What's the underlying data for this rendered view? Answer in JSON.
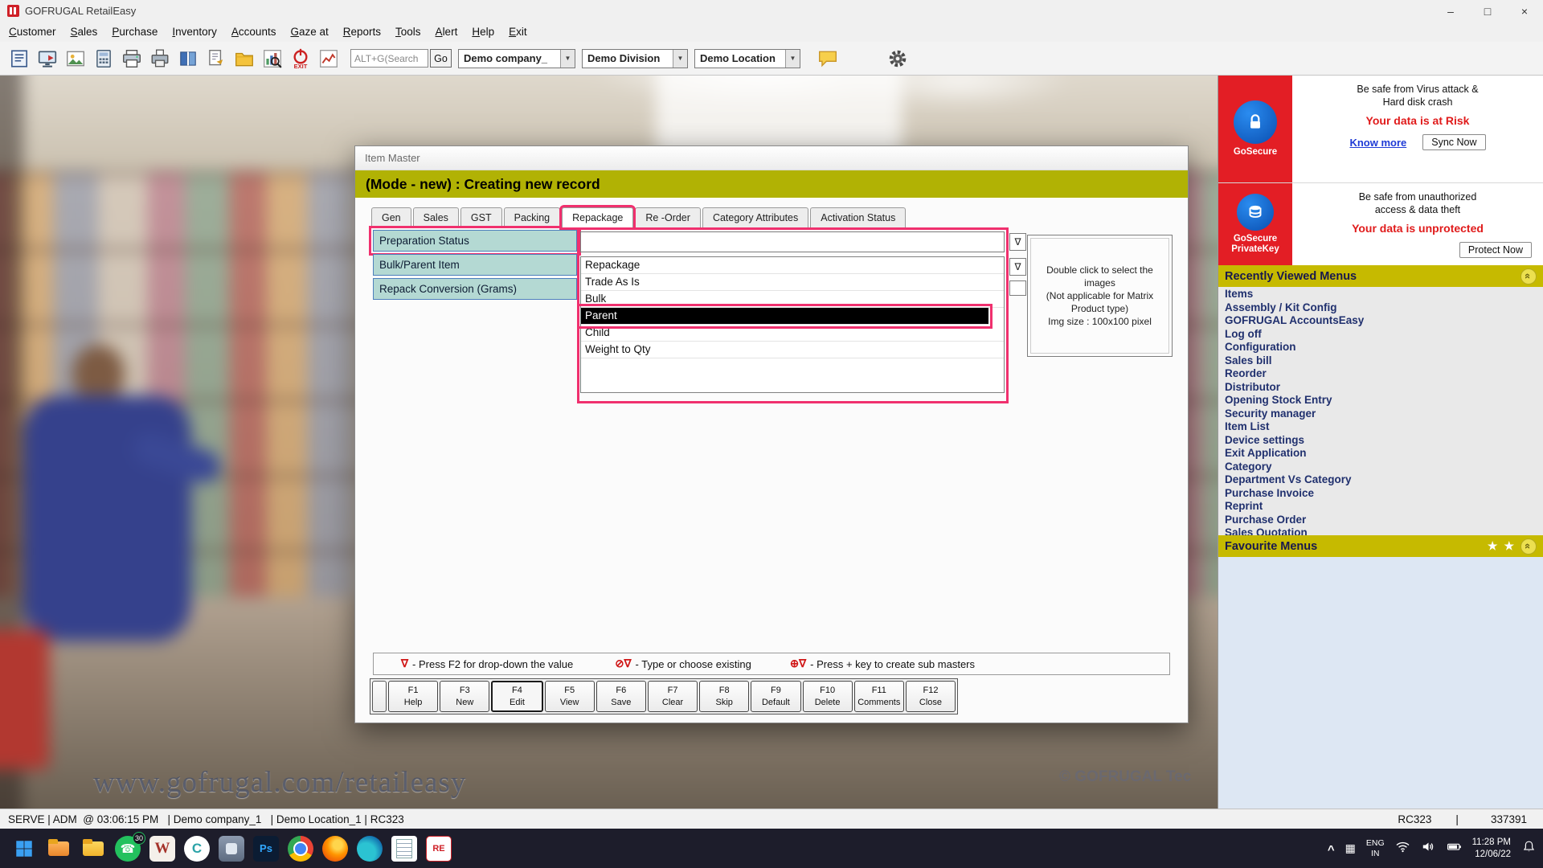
{
  "titlebar": {
    "title": "GOFRUGAL RetailEasy"
  },
  "icons": {
    "minimize": "–",
    "maximize": "□",
    "close": "×",
    "dropdown_arrow": "▼",
    "nabla": "∇",
    "collapse_chevron": "«",
    "tray_chevron": "^",
    "tray_grid": "▦",
    "star": "★",
    "phone": "☎",
    "word_w": "W",
    "c_app": "C",
    "ps": "Ps",
    "retaileasy": "RE"
  },
  "menubar": {
    "items": [
      "Customer",
      "Sales",
      "Purchase",
      "Inventory",
      "Accounts",
      "Gaze at",
      "Reports",
      "Tools",
      "Alert",
      "Help",
      "Exit"
    ]
  },
  "toolbar": {
    "search_value": "ALT+G(Search",
    "go": "Go",
    "exit_label": "EXIT",
    "company": "Demo company_",
    "division": "Demo Division",
    "location": "Demo Location"
  },
  "dialog": {
    "title": "Item Master",
    "mode_text": "(Mode - new) : Creating new record",
    "tabs": [
      "Gen",
      "Sales",
      "GST",
      "Packing",
      "Repackage",
      "Re -Order",
      "Category Attributes",
      "Activation Status"
    ],
    "active_tab": "Repackage",
    "fields": [
      "Preparation Status",
      "Bulk/Parent Item",
      "Repack Conversion (Grams)"
    ],
    "dropdown": {
      "items": [
        "Repackage",
        "Trade As Is",
        "Bulk",
        "Parent",
        "Child",
        "Weight to Qty"
      ],
      "selected": "Parent"
    },
    "image_box": {
      "line1": "Double click to select the",
      "line2": "images",
      "line3": "(Not applicable for Matrix",
      "line4": "Product type)",
      "line5": "Img size : 100x100 pixel"
    },
    "hints": [
      {
        "symbol": "∇",
        "text": "- Press F2 for drop-down the value"
      },
      {
        "symbol": "⊘∇",
        "text": "- Type or choose existing"
      },
      {
        "symbol": "⊕∇",
        "text": "- Press + key to create sub masters"
      }
    ],
    "fkeys": [
      {
        "key": "F1",
        "label": "Help"
      },
      {
        "key": "F3",
        "label": "New"
      },
      {
        "key": "F4",
        "label": "Edit"
      },
      {
        "key": "F5",
        "label": "View"
      },
      {
        "key": "F6",
        "label": "Save"
      },
      {
        "key": "F7",
        "label": "Clear"
      },
      {
        "key": "F8",
        "label": "Skip"
      },
      {
        "key": "F9",
        "label": "Default"
      },
      {
        "key": "F10",
        "label": "Delete"
      },
      {
        "key": "F11",
        "label": "Comments"
      },
      {
        "key": "F12",
        "label": "Close"
      }
    ]
  },
  "sidebar": {
    "ad1": {
      "brand": "GoSecure",
      "line1": "Be safe from Virus attack &",
      "line2": "Hard disk crash",
      "warning": "Your data is at Risk",
      "link": "Know more",
      "button": "Sync Now"
    },
    "ad2": {
      "brand1": "GoSecure",
      "brand2": "PrivateKey",
      "line1": "Be safe from unauthorized",
      "line2": "access & data theft",
      "warning": "Your data is unprotected",
      "button": "Protect Now"
    },
    "recent_header": "Recently Viewed Menus",
    "recent_items": [
      "Items",
      "Assembly / Kit Config",
      "GOFRUGAL AccountsEasy",
      "Log off",
      "Configuration",
      "Sales bill",
      "Reorder",
      "Distributor",
      "Opening Stock Entry",
      "Security manager",
      "Item List",
      "Device settings",
      "Exit Application",
      "Category",
      "Department Vs Category",
      "Purchase Invoice",
      "Reprint",
      "Purchase Order",
      "Sales Quotation"
    ],
    "favourite_header": "Favourite Menus"
  },
  "background": {
    "watermark": "www.gofrugal.com/retaileasy",
    "copyright": "© GOFRUGAL Tec"
  },
  "statusbar": {
    "text": "SERVE | ADM  @ 03:06:15 PM   | Demo company_1   | Demo Location_1 | RC323",
    "right_code": "RC323",
    "right_sep": "|",
    "right_num": "337391"
  },
  "taskbar": {
    "whatsapp_badge": "30",
    "lang_top": "ENG",
    "lang_bottom": "IN",
    "time": "11:28 PM",
    "date": "12/06/22"
  },
  "colors": {
    "annotation_pink": "#f0306e",
    "mode_bar_olive": "#b1b204",
    "sidebar_header_yellow": "#c6ba00",
    "ad_red": "#e31e25",
    "field_label_teal": "#b4d9d3"
  }
}
